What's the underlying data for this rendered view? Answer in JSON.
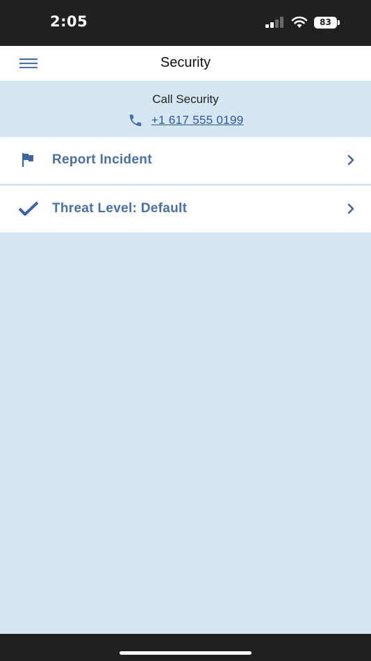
{
  "status_bar": {
    "time": "2:05",
    "battery_level": "83",
    "signal_bars": 2,
    "icons": [
      "signal-icon",
      "wifi-icon",
      "battery-icon"
    ]
  },
  "header": {
    "title": "Security",
    "menu_icon": "hamburger-menu-icon"
  },
  "call_panel": {
    "label": "Call Security",
    "phone_number": "+1 617 555 0199",
    "icon": "phone-icon"
  },
  "menu": {
    "items": [
      {
        "label": "Report Incident",
        "icon": "flag-icon",
        "trailing_icon": "chevron-right-icon"
      },
      {
        "label": "Threat Level: Default",
        "icon": "checkmark-icon",
        "trailing_icon": "chevron-right-icon"
      }
    ]
  },
  "colors": {
    "accent": "#4a6fa5",
    "link": "#2f5597",
    "background": "#d4e6f2",
    "status_bar": "#202020"
  }
}
